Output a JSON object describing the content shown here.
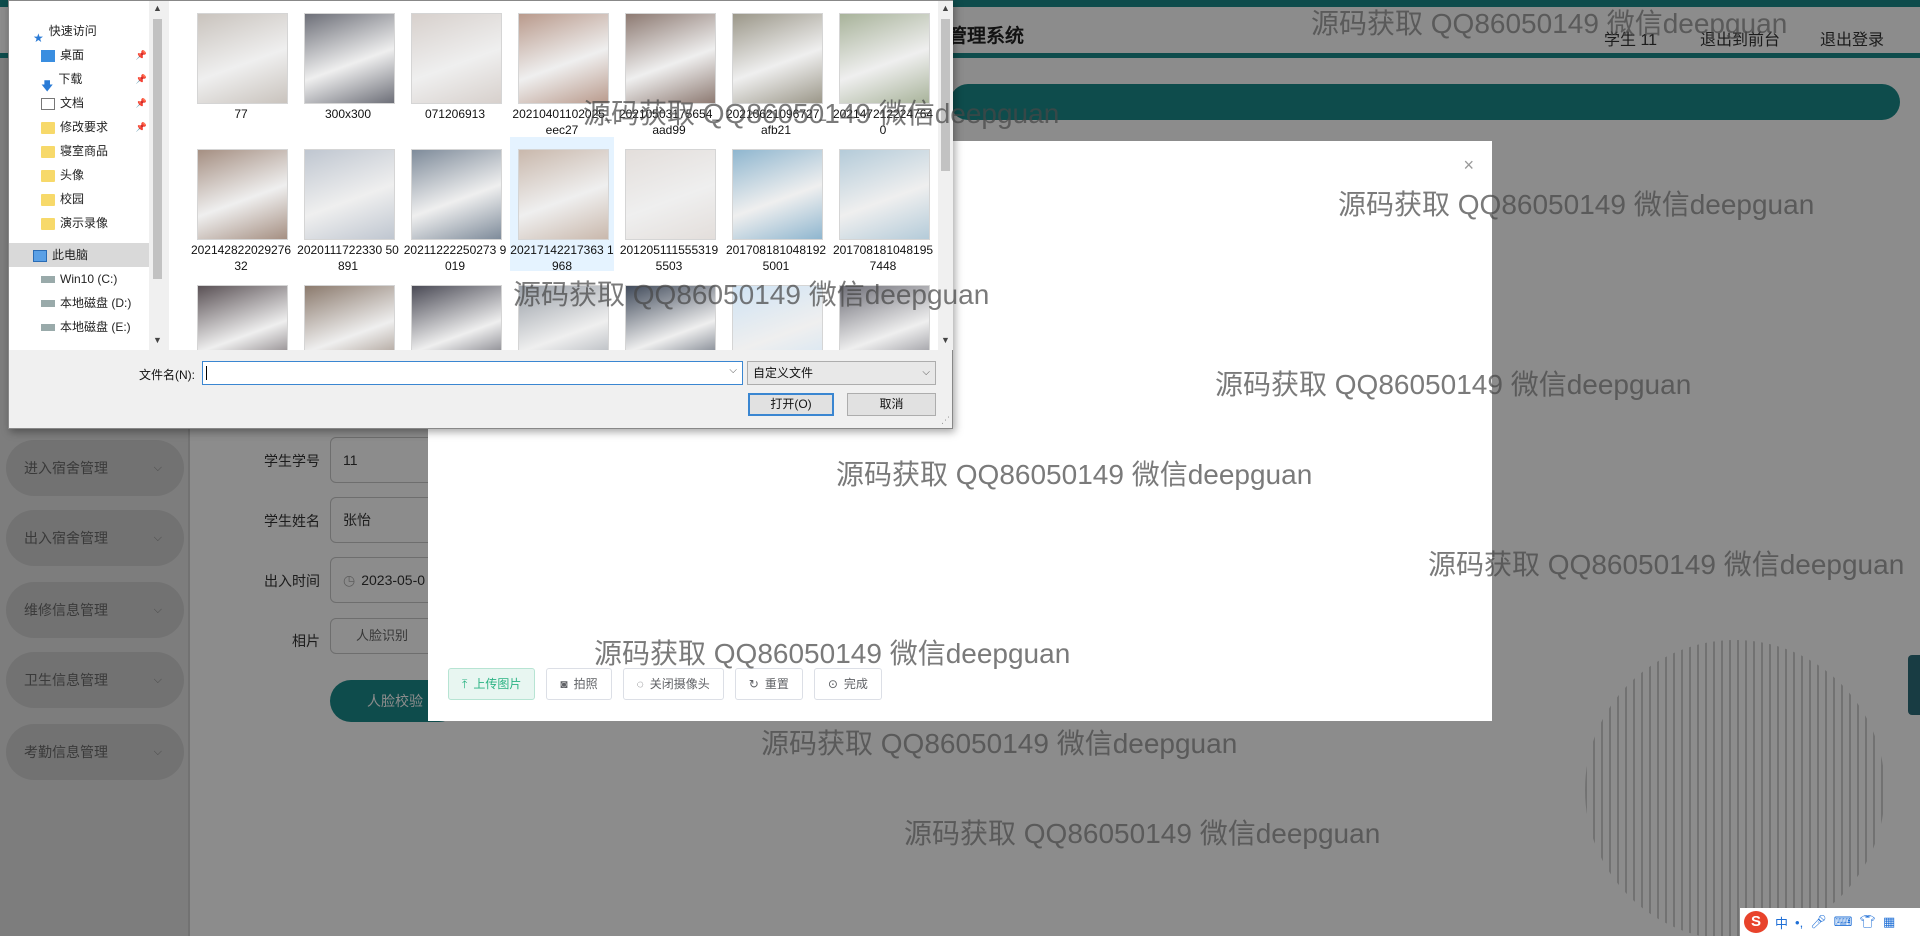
{
  "app": {
    "title": "管理系统",
    "user_label": "学生 11",
    "link_switch": "退出到前台",
    "link_logout": "退出登录",
    "menu": [
      {
        "label": "进入宿舍管理"
      },
      {
        "label": "出入宿舍管理"
      },
      {
        "label": "维修信息管理"
      },
      {
        "label": "卫生信息管理"
      },
      {
        "label": "考勤信息管理"
      }
    ],
    "form": {
      "student_no_label": "学生学号",
      "student_no_value": "11",
      "student_name_label": "学生姓名",
      "student_name_value": "张怡",
      "time_label": "出入时间",
      "time_value": "2023-05-0",
      "photo_label": "相片",
      "face_recognize_button": "人脸识别",
      "face_verify_button": "人脸校验"
    }
  },
  "camera_dialog": {
    "close_icon": "×",
    "buttons": {
      "upload": "上传图片",
      "capture": "拍照",
      "close_camera": "关闭摄像头",
      "reset": "重置",
      "done": "完成"
    }
  },
  "file_dialog": {
    "nav_items": [
      {
        "label": "快速访问",
        "icon": "star-icon"
      },
      {
        "label": "桌面",
        "icon": "desktop-icon"
      },
      {
        "label": "下载",
        "icon": "download-icon"
      },
      {
        "label": "文档",
        "icon": "document-icon"
      },
      {
        "label": "修改要求",
        "icon": "folder-icon"
      },
      {
        "label": "寝室商品",
        "icon": "folder-icon"
      },
      {
        "label": "头像",
        "icon": "folder-icon"
      },
      {
        "label": "校园",
        "icon": "folder-icon"
      },
      {
        "label": "演示录像",
        "icon": "folder-icon"
      },
      {
        "label": "此电脑",
        "icon": "computer-icon"
      },
      {
        "label": "Win10 (C:)",
        "icon": "drive-icon"
      },
      {
        "label": "本地磁盘 (D:)",
        "icon": "drive-icon"
      },
      {
        "label": "本地磁盘 (E:)",
        "icon": "drive-icon"
      }
    ],
    "files": [
      {
        "name": "77"
      },
      {
        "name": "300x300"
      },
      {
        "name": "071206913"
      },
      {
        "name": "20210401102025_eec27"
      },
      {
        "name": "20210503175654_aad99"
      },
      {
        "name": "20210621096727_afb21"
      },
      {
        "name": "2021472122247640"
      },
      {
        "name": "20214282202927632"
      },
      {
        "name": "2020111722330 50891"
      },
      {
        "name": "20211222250273 9019"
      },
      {
        "name": "20217142217363 1968"
      },
      {
        "name": "2012051115553195503"
      },
      {
        "name": "2017081810481925001"
      },
      {
        "name": "2017081810481957448"
      },
      {
        "name": ""
      },
      {
        "name": ""
      },
      {
        "name": ""
      },
      {
        "name": ""
      },
      {
        "name": ""
      },
      {
        "name": ""
      },
      {
        "name": ""
      }
    ],
    "filename_label": "文件名(N):",
    "filename_value": "",
    "filetype_value": "自定义文件",
    "open_button": "打开(O)",
    "cancel_button": "取消"
  },
  "watermark_text": "源码获取 QQ86050149 微信deepguan",
  "tray": {
    "ime_logo": "S",
    "lang": "中",
    "punct": "•,",
    "mic_icon": "mic-icon",
    "keyboard_icon": "keyboard-icon",
    "shirt_icon": "shirt-icon",
    "grid_icon": "grid-icon"
  }
}
